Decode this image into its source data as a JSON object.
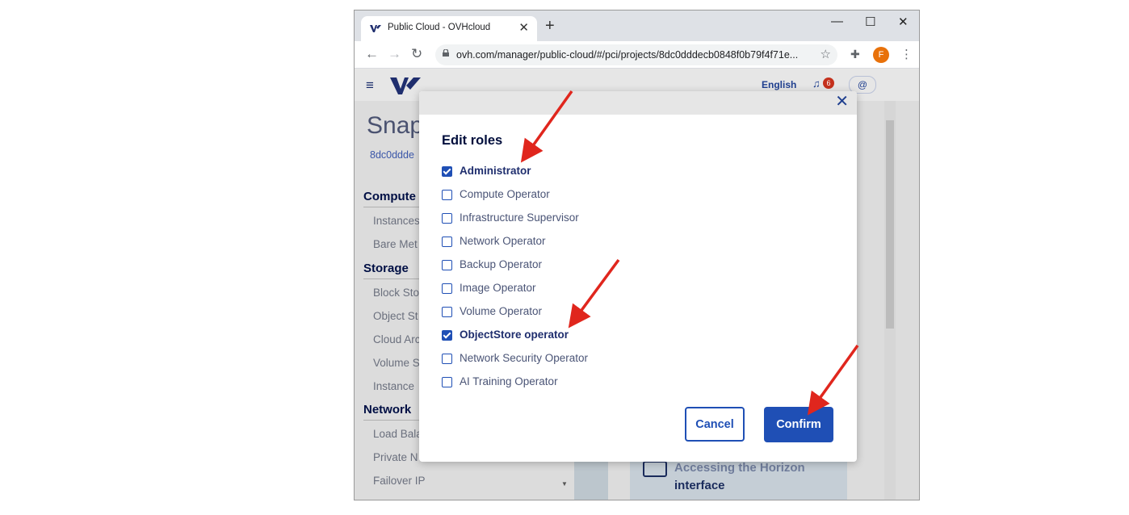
{
  "browser": {
    "tab_title": "Public Cloud - OVHcloud",
    "tab_close": "✕",
    "new_tab": "+",
    "url": "ovh.com/manager/public-cloud/#/pci/projects/8dc0dddecb0848f0b79f4f71e...",
    "profile_initial": "F",
    "window_minimize": "—",
    "window_maximize": "☐",
    "window_close": "✕"
  },
  "app": {
    "language": "English",
    "notification_count": "6"
  },
  "background": {
    "page_title": "Snap",
    "project_id": "8dc0ddde",
    "sections": [
      {
        "heading": "Compute",
        "items": [
          "Instances",
          "Bare Met"
        ]
      },
      {
        "heading": "Storage",
        "items": [
          "Block Sto",
          "Object St",
          "Cloud Arc",
          "Volume S",
          "Instance"
        ]
      },
      {
        "heading": "Network",
        "items": [
          "Load Bala",
          "Private N",
          "Failover IP"
        ]
      }
    ],
    "card_text": "interface",
    "card_text_blurred": "Accessing the Horizon"
  },
  "modal": {
    "title": "Edit roles",
    "close": "✕",
    "roles": [
      {
        "label": "Administrator",
        "checked": true
      },
      {
        "label": "Compute Operator",
        "checked": false
      },
      {
        "label": "Infrastructure Supervisor",
        "checked": false
      },
      {
        "label": "Network Operator",
        "checked": false
      },
      {
        "label": "Backup Operator",
        "checked": false
      },
      {
        "label": "Image Operator",
        "checked": false
      },
      {
        "label": "Volume Operator",
        "checked": false
      },
      {
        "label": "ObjectStore operator",
        "checked": true
      },
      {
        "label": "Network Security Operator",
        "checked": false
      },
      {
        "label": "AI Training Operator",
        "checked": false
      }
    ],
    "cancel_label": "Cancel",
    "confirm_label": "Confirm"
  },
  "colors": {
    "primary": "#1f4fb5",
    "annotation_arrow": "#e0261d",
    "heading": "#000e3c"
  }
}
